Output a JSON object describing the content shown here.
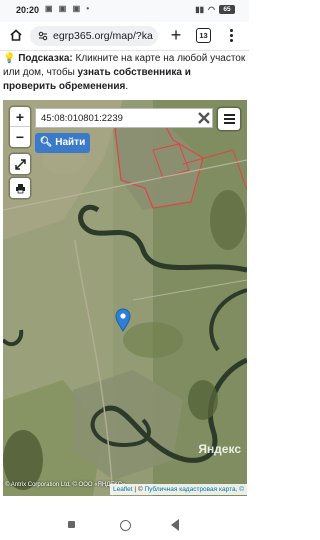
{
  "status_bar": {
    "time": "20:20",
    "left_icons": [
      "notification-icon",
      "notification-icon",
      "notification-icon",
      "more-icon"
    ],
    "battery": "65"
  },
  "browser": {
    "url": "egrp365.org/map/?ka",
    "tab_count": "13"
  },
  "hint": {
    "label": "Подсказка:",
    "text_1": " Кликните на карте на любой участок или дом, чтобы ",
    "bold": "узнать собственника и проверить обременения",
    "text_2": "."
  },
  "map": {
    "zoom_in": "+",
    "zoom_out": "−",
    "search_value": "45:08:010801:2239",
    "find_label": "Найти",
    "yandex_logo": "Яндекс",
    "copyright": "© Antrix Corporation Ltd, © OOO «ЯНДЕКС»",
    "attribution_leaflet": "Leaflet",
    "attribution_sep": " | © ",
    "attribution_public": "Публичная кадастровая карта, ©",
    "colors": {
      "find_button": "#3b7ac9",
      "cadastre_border": "#e04444",
      "marker": "#2e7fd6"
    }
  }
}
